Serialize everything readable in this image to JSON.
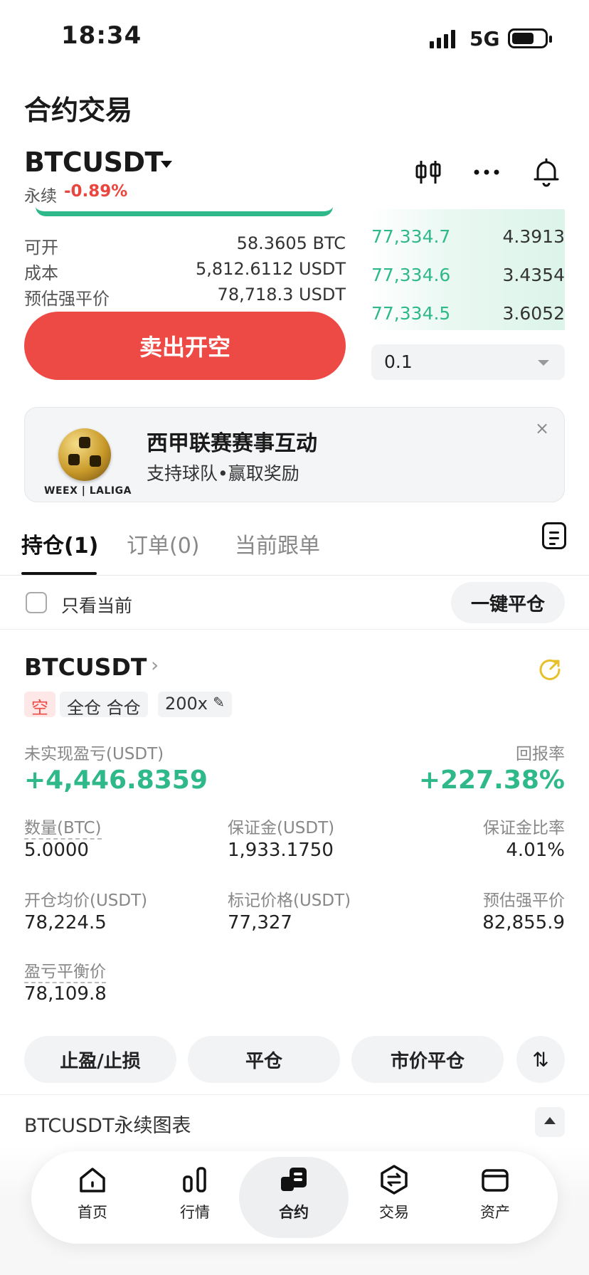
{
  "status_bar": {
    "time": "18:34",
    "network": "5G"
  },
  "header": {
    "title": "合约交易",
    "symbol": "BTCUSDT",
    "contract_type": "永续",
    "change": "-0.89%"
  },
  "info": {
    "rows": [
      {
        "label": "可开",
        "value": "58.3605 BTC"
      },
      {
        "label": "成本",
        "value": "5,812.6112 USDT"
      },
      {
        "label": "预估强平价",
        "value": "78,718.3 USDT"
      }
    ]
  },
  "sell_button": "卖出开空",
  "order_book": {
    "rows": [
      {
        "price": "77,334.7",
        "qty": "4.3913"
      },
      {
        "price": "77,334.6",
        "qty": "3.4354"
      },
      {
        "price": "77,334.5",
        "qty": "3.6052"
      }
    ],
    "step_value": "0.1"
  },
  "banner": {
    "title": "西甲联赛赛事互动",
    "subtitle": "支持球队•赢取奖励",
    "brand": "WEEX | LALIGA",
    "close": "×"
  },
  "tabs": [
    "持仓(1)",
    "订单(0)",
    "当前跟单"
  ],
  "filter": {
    "label": "只看当前",
    "close_all": "一键平仓"
  },
  "position": {
    "symbol": "BTCUSDT",
    "side": "空",
    "margin_mode": "全仓 合仓",
    "leverage": "200x",
    "pnl_label": "未实现盈亏(USDT)",
    "pnl": "+4,446.8359",
    "roe_label": "回报率",
    "roe": "+227.38%",
    "qty_label": "数量(BTC)",
    "qty": "5.0000",
    "margin_label": "保证金(USDT)",
    "margin": "1,933.1750",
    "margin_ratio_label": "保证金比率",
    "margin_ratio": "4.01%",
    "entry_label": "开仓均价(USDT)",
    "entry": "78,224.5",
    "mark_label": "标记价格(USDT)",
    "mark": "77,327",
    "liq_label": "预估强平价",
    "liq": "82,855.9",
    "breakeven_label": "盈亏平衡价",
    "breakeven": "78,109.8"
  },
  "actions": {
    "tpsl": "止盈/止损",
    "close": "平仓",
    "market_close": "市价平仓",
    "swap": "⇅"
  },
  "chart_row": {
    "label": "BTCUSDT永续图表"
  },
  "nav": [
    {
      "label": "首页",
      "icon": "home-icon"
    },
    {
      "label": "行情",
      "icon": "market-bars-icon"
    },
    {
      "label": "合约",
      "icon": "futures-icon"
    },
    {
      "label": "交易",
      "icon": "exchange-icon"
    },
    {
      "label": "资产",
      "icon": "wallet-icon"
    }
  ],
  "colors": {
    "accent_red": "#ee4a45",
    "accent_green": "#2fb98a"
  }
}
